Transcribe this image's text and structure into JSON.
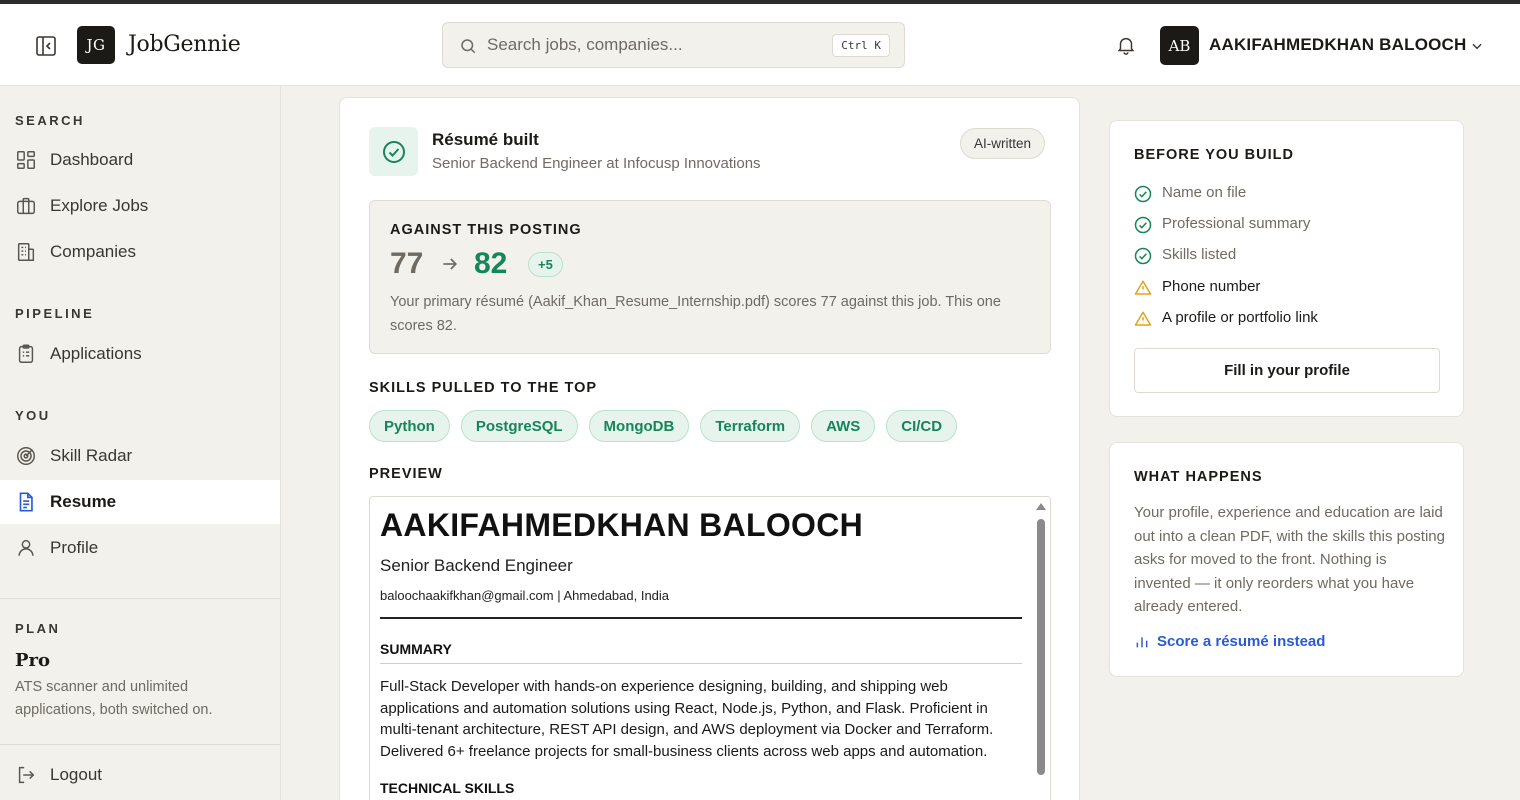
{
  "app": {
    "logo_initials": "JG",
    "name": "JobGennie"
  },
  "search": {
    "placeholder": "Search jobs, companies...",
    "shortcut": "Ctrl K"
  },
  "user": {
    "initials": "AB",
    "name": "AAKIFAHMEDKHAN BALOOCH"
  },
  "sidebar": {
    "sections": {
      "search": "SEARCH",
      "pipeline": "PIPELINE",
      "you": "YOU",
      "plan": "PLAN"
    },
    "items": {
      "dashboard": "Dashboard",
      "explore_jobs": "Explore Jobs",
      "companies": "Companies",
      "applications": "Applications",
      "skill_radar": "Skill Radar",
      "resume": "Resume",
      "profile": "Profile",
      "logout": "Logout"
    },
    "active": "resume",
    "plan": {
      "name": "Pro",
      "description": "ATS scanner and unlimited applications, both switched on."
    }
  },
  "main": {
    "built": {
      "title": "Résumé built",
      "subtitle": "Senior Backend Engineer at Infocusp Innovations",
      "badge": "AI-written"
    },
    "posting": {
      "label": "AGAINST THIS POSTING",
      "old_score": "77",
      "new_score": "82",
      "delta": "+5",
      "description": "Your primary résumé (Aakif_Khan_Resume_Internship.pdf) scores 77 against this job. This one scores 82."
    },
    "skills": {
      "label": "SKILLS PULLED TO THE TOP",
      "items": [
        "Python",
        "PostgreSQL",
        "MongoDB",
        "Terraform",
        "AWS",
        "CI/CD"
      ]
    },
    "preview": {
      "label": "PREVIEW",
      "name": "AAKIFAHMEDKHAN BALOOCH",
      "title": "Senior Backend Engineer",
      "contact": "baloochaakifkhan@gmail.com | Ahmedabad, India",
      "summary_heading": "SUMMARY",
      "summary_text": "Full-Stack Developer with hands-on experience designing, building, and shipping web applications and automation solutions using React, Node.js, Python, and Flask. Proficient in multi-tenant architecture, REST API design, and AWS deployment via Docker and Terraform. Delivered 6+ freelance projects for small-business clients across web apps and automation.",
      "skills_heading": "TECHNICAL SKILLS"
    }
  },
  "before_build": {
    "title": "BEFORE YOU BUILD",
    "items": [
      {
        "label": "Name on file",
        "status": "done"
      },
      {
        "label": "Professional summary",
        "status": "done"
      },
      {
        "label": "Skills listed",
        "status": "done"
      },
      {
        "label": "Phone number",
        "status": "warning"
      },
      {
        "label": "A profile or portfolio link",
        "status": "warning"
      }
    ],
    "button": "Fill in your profile"
  },
  "what_happens": {
    "title": "WHAT HAPPENS",
    "description": "Your profile, experience and education are laid out into a clean PDF, with the skills this posting asks for moved to the front. Nothing is invented — it only reorders what you have already entered.",
    "link": "Score a résumé instead"
  },
  "colors": {
    "accent_green": "#16855a",
    "accent_blue": "#2a5bd7",
    "warning": "#e0a21b",
    "background": "#f3f1ec"
  }
}
